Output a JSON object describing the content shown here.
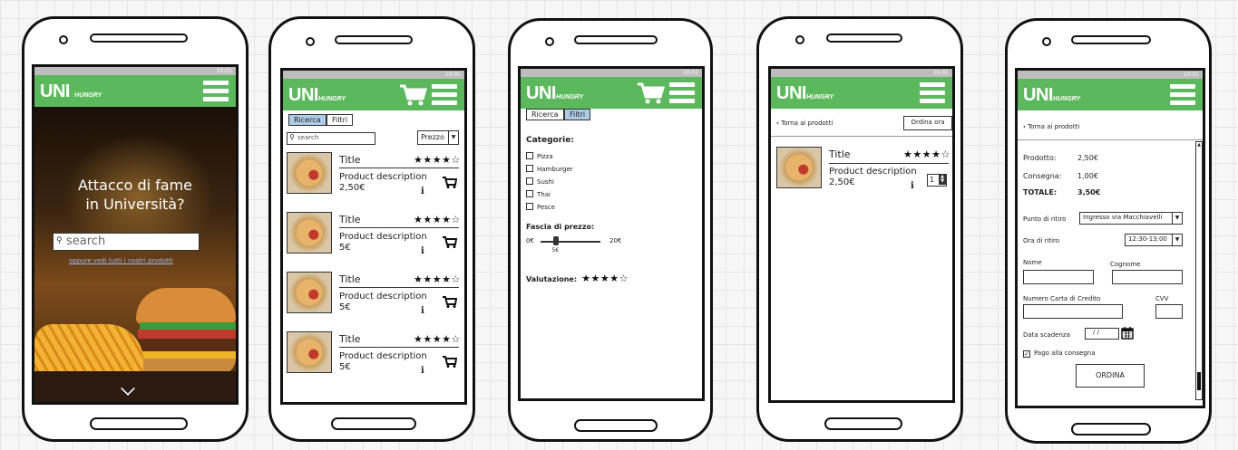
{
  "status": {
    "time": "10:01"
  },
  "screen1": {
    "logo_main": "UNI",
    "logo_sub": "HUNGRY",
    "headline_line1": "Attacco di fame",
    "headline_line2": "in Università?",
    "search_placeholder": "search",
    "link": "oppure vedi tutti i nostri prodotti"
  },
  "screen2": {
    "logo_main": "UNI",
    "logo_sub": "HUNGRY",
    "tabs": [
      {
        "label": "Ricerca"
      },
      {
        "label": "Filtri"
      }
    ],
    "search_placeholder": "search",
    "sort_value": "Prezzo",
    "products": [
      {
        "title": "Title",
        "rating": "★★★★☆",
        "description": "Product description",
        "price": "2,50€"
      },
      {
        "title": "Title",
        "rating": "★★★★☆",
        "description": "Product description",
        "price": "5€"
      },
      {
        "title": "Title",
        "rating": "★★★★☆",
        "description": "Product description",
        "price": "5€"
      },
      {
        "title": "Title",
        "rating": "★★★★☆",
        "description": "Product description",
        "price": "5€"
      }
    ]
  },
  "screen3": {
    "logo_main": "UNI",
    "logo_sub": "HUNGRY",
    "tabs": [
      {
        "label": "Ricerca"
      },
      {
        "label": "Filtri"
      }
    ],
    "categories_title": "Categorie:",
    "categories": [
      "Pizza",
      "Hamburger",
      "Sushi",
      "Thai",
      "Pesce"
    ],
    "price_title": "Fascia di prezzo:",
    "price_min": "0€",
    "price_max": "20€",
    "price_value": "5€",
    "price_fraction": 0.25,
    "rating_title": "Valutazione:",
    "rating": "★★★★☆"
  },
  "screen4": {
    "logo_main": "UNI",
    "logo_sub": "HUNGRY",
    "back_label": "Torna ai prodotti",
    "order_now": "Ordina ora",
    "product": {
      "title": "Title",
      "rating": "★★★★☆",
      "description": "Product description",
      "price": "2,50€",
      "quantity": "1"
    }
  },
  "screen5": {
    "logo_main": "UNI",
    "logo_sub": "HUNGRY",
    "back_label": "Torna ai prodotti",
    "prodotto_label": "Prodotto:",
    "prodotto_value": "2,50€",
    "consegna_label": "Consegna:",
    "consegna_value": "1,00€",
    "totale_label": "TOTALE:",
    "totale_value": "3,50€",
    "punto_label": "Punto di ritiro",
    "punto_value": "Ingresso via Macchiavelli",
    "ora_label": "Ora di ritiro",
    "ora_value": "12:30-13:00",
    "nome_label": "Nome",
    "cognome_label": "Cognome",
    "carta_label": "Numero Carta di Credito",
    "cvv_label": "CVV",
    "scadenza_label": "Data scadenza",
    "scadenza_value": "/ /",
    "pago_label": "Pago alla consegna",
    "pago_checked": true,
    "ordina_button": "ORDINA"
  }
}
